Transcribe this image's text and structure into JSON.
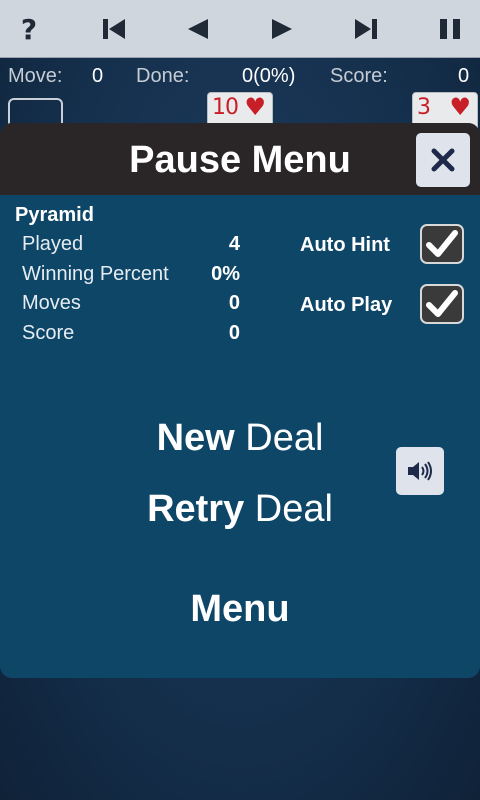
{
  "toolbar": {
    "help_glyph": "?",
    "icons": [
      "help-icon",
      "skip-to-start-icon",
      "step-back-icon",
      "step-forward-icon",
      "skip-to-end-icon",
      "pause-icon"
    ]
  },
  "status": {
    "move_label": "Move:",
    "move_value": "0",
    "done_label": "Done:",
    "done_value": "0(0%)",
    "score_label": "Score:",
    "score_value": "0"
  },
  "background_cards": [
    {
      "rank": "10",
      "suit": "♥"
    },
    {
      "rank": "3",
      "suit": "♥"
    }
  ],
  "pause_menu": {
    "title": "Pause Menu",
    "game_name": "Pyramid",
    "stats": [
      {
        "label": "Played",
        "value": "4"
      },
      {
        "label": "Winning Percent",
        "value": "0%"
      },
      {
        "label": "Moves",
        "value": "0"
      },
      {
        "label": "Score",
        "value": "0"
      }
    ],
    "options": [
      {
        "label": "Auto Hint",
        "checked": true
      },
      {
        "label": "Auto Play",
        "checked": true
      }
    ],
    "new_deal": {
      "bold": "New",
      "rest": " Deal"
    },
    "retry_deal": {
      "bold": "Retry",
      "rest": " Deal"
    },
    "menu_label": "Menu"
  },
  "colors": {
    "panel": "#0e4667",
    "header": "#2a2627",
    "toolbar": "#cfd6de",
    "card_red": "#c81e28"
  }
}
